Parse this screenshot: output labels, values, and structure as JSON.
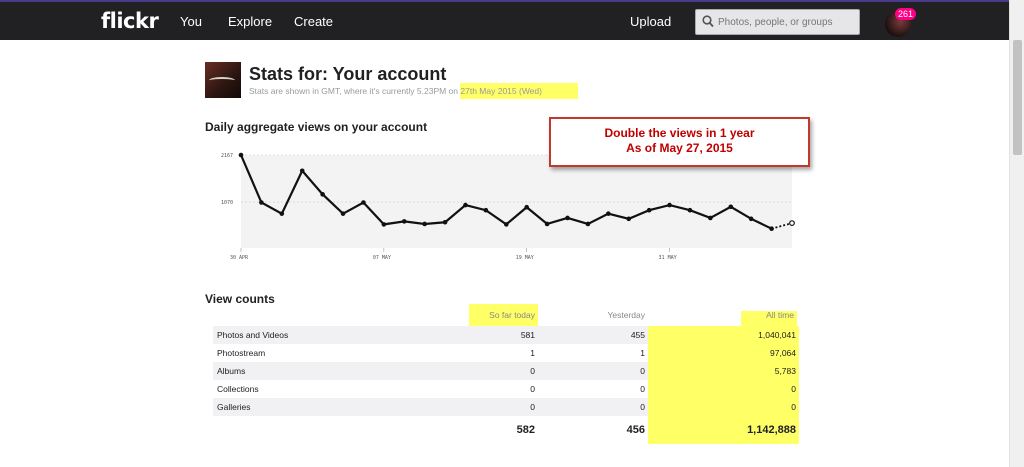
{
  "topbar": {
    "logo": "flickr",
    "nav": [
      "You",
      "Explore",
      "Create"
    ],
    "upload": "Upload",
    "search_placeholder": "Photos, people, or groups",
    "notification_count": "261"
  },
  "header": {
    "title": "Stats for: Your account",
    "subtitle_prefix": "Stats are shown in GMT, where it's currently 5.23PM on ",
    "subtitle_date": "27th May 2015 (Wed)"
  },
  "chart_section": {
    "heading": "Daily aggregate views on your account"
  },
  "annotation": {
    "line1": "Double the views in 1 year",
    "line2": "As of May 27, 2015"
  },
  "chart_data": {
    "type": "line",
    "title": "Daily aggregate views on your account",
    "x_ticks": [
      "30 APR",
      "07 MAY",
      "19 MAY",
      "31 MAY"
    ],
    "y_ticks": [
      "2167",
      "1070"
    ],
    "y_tick_values": [
      2167,
      1070
    ],
    "ylim": [
      0,
      2167
    ],
    "series": [
      {
        "values": [
          2167,
          1060,
          800,
          1800,
          1250,
          800,
          1060,
          550,
          620,
          560,
          600,
          1000,
          880,
          550,
          950,
          560,
          700,
          560,
          800,
          680,
          880,
          1000,
          880,
          700,
          960,
          680,
          450
        ]
      },
      {
        "values": [
          null,
          null,
          null,
          null,
          null,
          null,
          null,
          null,
          null,
          null,
          null,
          null,
          null,
          null,
          null,
          null,
          null,
          null,
          null,
          null,
          null,
          null,
          null,
          null,
          null,
          null,
          450,
          580
        ],
        "style": "dotted"
      }
    ],
    "grid": true,
    "legend": "none"
  },
  "view_counts": {
    "heading": "View counts",
    "columns": [
      "So far today",
      "Yesterday",
      "All time"
    ],
    "rows": [
      {
        "label": "Photos and Videos",
        "today": "581",
        "yesterday": "455",
        "all_time": "1,040,041"
      },
      {
        "label": "Photostream",
        "today": "1",
        "yesterday": "1",
        "all_time": "97,064"
      },
      {
        "label": "Albums",
        "today": "0",
        "yesterday": "0",
        "all_time": "5,783"
      },
      {
        "label": "Collections",
        "today": "0",
        "yesterday": "0",
        "all_time": "0"
      },
      {
        "label": "Galleries",
        "today": "0",
        "yesterday": "0",
        "all_time": "0"
      }
    ],
    "totals": {
      "today": "582",
      "yesterday": "456",
      "all_time": "1,142,888"
    }
  },
  "colors": {
    "topbar": "#212124",
    "highlight": "#ffff66",
    "annotation_border": "#c0392b",
    "annotation_text": "#c00000",
    "badge": "#ff0084"
  }
}
